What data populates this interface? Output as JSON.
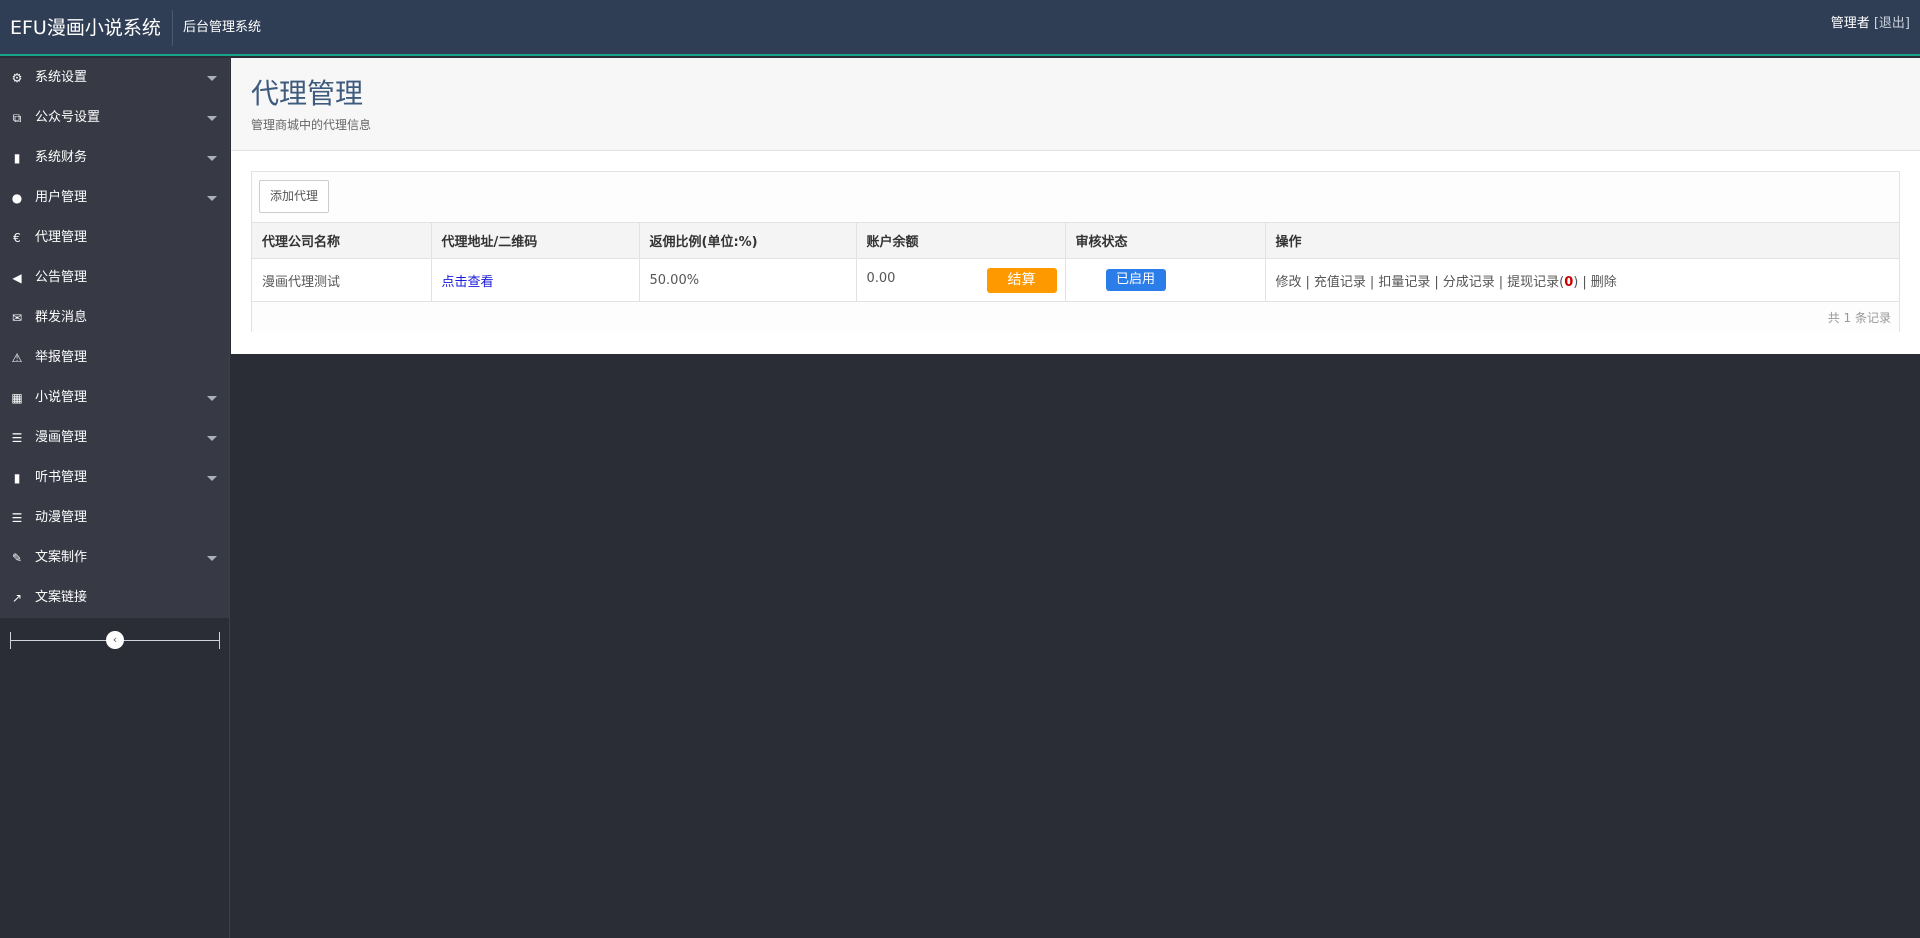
{
  "navbar": {
    "brand": "EFU漫画小说系统",
    "subtitle": "后台管理系统",
    "user_label": "管理者",
    "logout_label": "[退出]"
  },
  "sidebar": {
    "items": [
      {
        "label": "系统设置",
        "icon": "gear-icon",
        "glyph": "⚙",
        "has_children": true
      },
      {
        "label": "公众号设置",
        "icon": "tags-icon",
        "glyph": "⧉",
        "has_children": true
      },
      {
        "label": "系统财务",
        "icon": "bar-chart-icon",
        "glyph": "▮",
        "has_children": true
      },
      {
        "label": "用户管理",
        "icon": "user-icon",
        "glyph": "●",
        "has_children": true
      },
      {
        "label": "代理管理",
        "icon": "euro-icon",
        "glyph": "€",
        "has_children": false
      },
      {
        "label": "公告管理",
        "icon": "bullhorn-icon",
        "glyph": "◀",
        "has_children": false
      },
      {
        "label": "群发消息",
        "icon": "envelope-icon",
        "glyph": "✉",
        "has_children": false
      },
      {
        "label": "举报管理",
        "icon": "warning-icon",
        "glyph": "⚠",
        "has_children": false
      },
      {
        "label": "小说管理",
        "icon": "grid-icon",
        "glyph": "▦",
        "has_children": true
      },
      {
        "label": "漫画管理",
        "icon": "list-icon",
        "glyph": "☰",
        "has_children": true
      },
      {
        "label": "听书管理",
        "icon": "sitemap-icon",
        "glyph": "▮",
        "has_children": true
      },
      {
        "label": "动漫管理",
        "icon": "list-icon",
        "glyph": "☰",
        "has_children": false
      },
      {
        "label": "文案制作",
        "icon": "edit-icon",
        "glyph": "✎",
        "has_children": true
      },
      {
        "label": "文案链接",
        "icon": "external-link-icon",
        "glyph": "↗",
        "has_children": false
      }
    ],
    "collapse_glyph": "‹"
  },
  "header": {
    "title": "代理管理",
    "description": "管理商城中的代理信息"
  },
  "toolbar": {
    "add_label": "添加代理"
  },
  "table": {
    "columns": [
      "代理公司名称",
      "代理地址/二维码",
      "返佣比例(单位:%)",
      "账户余额",
      "审核状态",
      "操作"
    ],
    "rows": [
      {
        "name": "漫画代理测试",
        "link_label": "点击查看",
        "ratio": "50.00%",
        "balance": "0.00",
        "settle_label": "结算",
        "status": "已启用",
        "op_edit": "修改",
        "op_recharge": "充值记录",
        "op_deduct": "扣量记录",
        "op_commission": "分成记录",
        "op_withdraw": "提现记录",
        "op_withdraw_count": "0",
        "op_delete": "删除"
      }
    ],
    "footer": "共 1 条记录"
  }
}
